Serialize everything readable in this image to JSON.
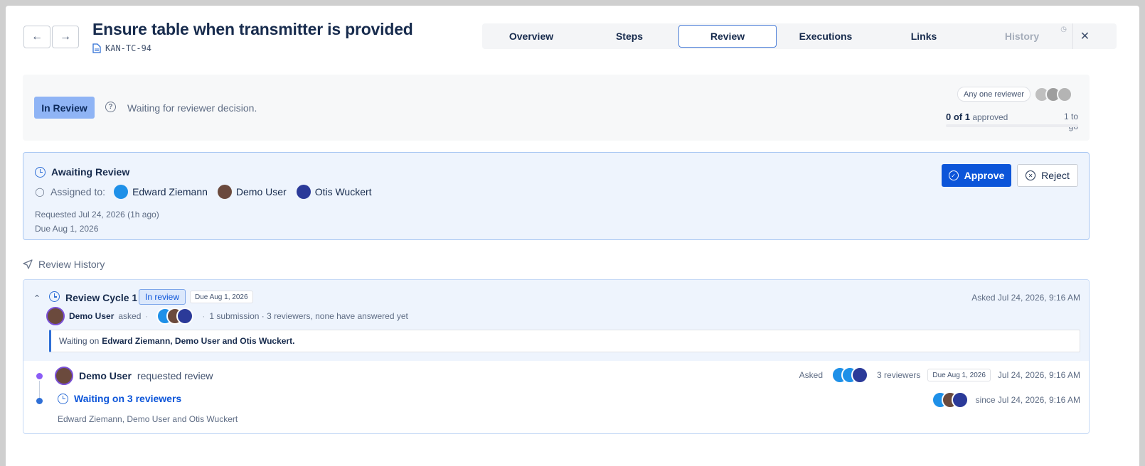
{
  "header": {
    "title": "Ensure table when transmitter is provided",
    "key": "KAN-TC-94"
  },
  "tabs": [
    {
      "label": "Overview"
    },
    {
      "label": "Steps"
    },
    {
      "label": "Review"
    },
    {
      "label": "Executions"
    },
    {
      "label": "Links"
    },
    {
      "label": "History"
    }
  ],
  "status": {
    "badge": "In Review",
    "text": "Waiting for reviewer decision.",
    "policy": "Any one reviewer",
    "approved_count": "0 of 1",
    "approved_label": "approved",
    "to_go": "1 to go",
    "progress": 0
  },
  "awaiting": {
    "title": "Awaiting Review",
    "assigned_label": "Assigned to:",
    "assignees": [
      "Edward Ziemann",
      "Demo User",
      "Otis Wuckert"
    ],
    "requested": "Requested Jul 24, 2026 (1h ago)",
    "due": "Due Aug 1, 2026",
    "approve_label": "Approve",
    "reject_label": "Reject"
  },
  "history": {
    "label": "Review History",
    "cycle": {
      "title": "Review Cycle 1",
      "status": "In review",
      "due": "Due Aug 1, 2026",
      "asked_at": "Asked Jul 24, 2026, 9:16 AM",
      "asker": "Demo User",
      "asked_word": "asked",
      "summary": "1 submission · 3 reviewers, none have answered yet",
      "waiting_prefix": "Waiting on",
      "waiting_names": "Edward Ziemann, Demo User and Otis Wuckert."
    },
    "event1": {
      "name": "Demo User",
      "action": "requested review",
      "asked": "Asked",
      "reviewers": "3 reviewers",
      "due": "Due Aug 1, 2026",
      "time": "Jul 24, 2026, 9:16 AM"
    },
    "event2": {
      "title": "Waiting on 3 reviewers",
      "since": "since Jul 24, 2026, 9:16 AM",
      "names": "Edward Ziemann, Demo User and Otis Wuckert"
    }
  },
  "colors": {
    "accent": "#0c55d9",
    "in_review_badge": "#8fb4f5",
    "card_bg": "#eef4fd"
  }
}
